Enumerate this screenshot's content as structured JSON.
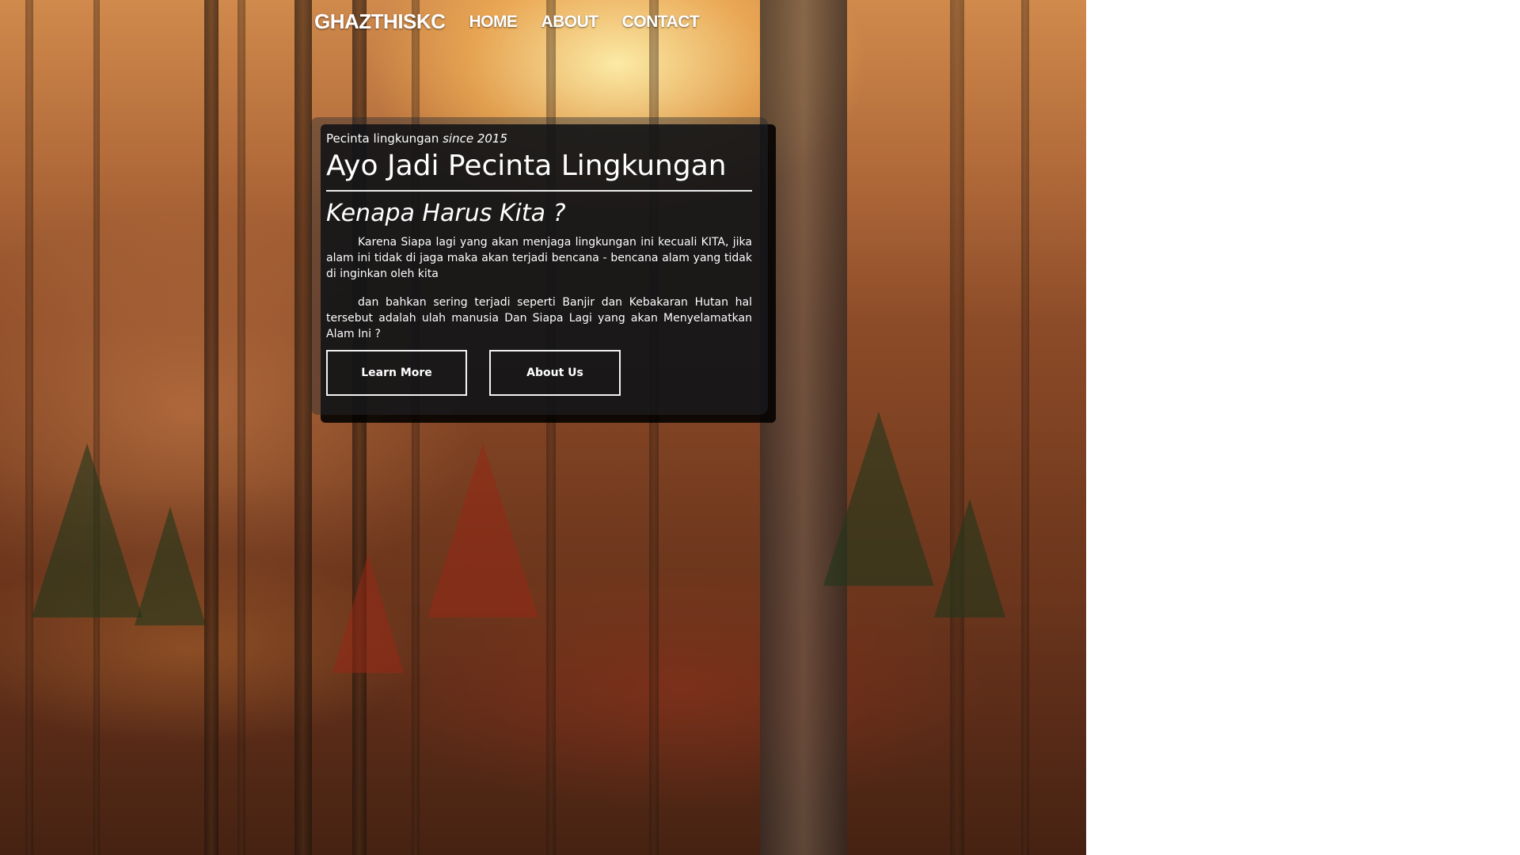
{
  "nav": {
    "brand": "GHAZTHISKC",
    "links": [
      "HOME",
      "ABOUT",
      "CONTACT"
    ]
  },
  "hero": {
    "tagline_prefix": "Pecinta lingkungan ",
    "tagline_since": "since 2015",
    "title": "Ayo Jadi Pecinta Lingkungan",
    "subtitle": "Kenapa Harus Kita ?",
    "paragraphs": [
      "Karena Siapa lagi yang akan menjaga lingkungan ini kecuali KITA, jika alam ini tidak di jaga maka akan terjadi bencana - bencana alam yang tidak di inginkan oleh kita",
      "dan bahkan sering terjadi seperti Banjir dan Kebakaran Hutan hal tersebut adalah ulah manusia Dan Siapa Lagi yang akan Menyelamatkan Alam Ini ?"
    ],
    "buttons": {
      "learn_more": "Learn More",
      "about_us": "About Us"
    }
  },
  "colors": {
    "text": "#ffffff",
    "card_overlay": "rgba(40,45,50,0.43)",
    "card_shadow": "rgba(0,0,0,0.88)",
    "page_background": "#ffffff"
  },
  "background": {
    "scene": "autumn forest with sunlight through trees"
  }
}
